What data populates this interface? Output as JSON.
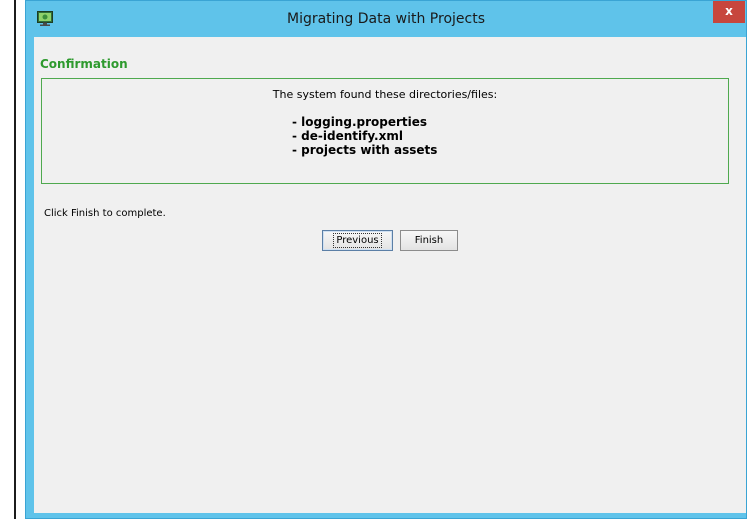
{
  "window": {
    "title": "Migrating Data with Projects",
    "icon": "monitor-app-icon",
    "close_label": "x",
    "title_bar_color": "#5fc3ea",
    "close_color": "#c7463d"
  },
  "confirmation": {
    "section_title": "Confirmation",
    "found_message": "The system found these directories/files:",
    "items": [
      "- logging.properties",
      "- de-identify.xml",
      "- projects with assets"
    ],
    "accent_color": "#2e9a2e"
  },
  "footer": {
    "hint": "Click Finish to complete.",
    "previous_label": "Previous",
    "finish_label": "Finish"
  }
}
